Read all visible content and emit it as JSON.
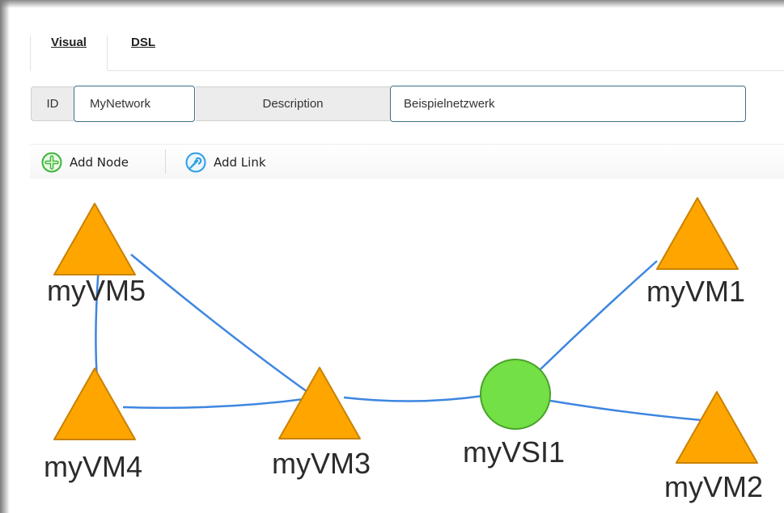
{
  "tabs": [
    {
      "label": "Visual",
      "active": true
    },
    {
      "label": "DSL",
      "active": false
    }
  ],
  "form": {
    "id_label": "ID",
    "id_value": "MyNetwork",
    "description_label": "Description",
    "description_value": "Beispielnetzwerk"
  },
  "toolbar": {
    "add_node_label": "Add Node",
    "add_node_icon": "plus-circle-icon",
    "add_link_label": "Add Link",
    "add_link_icon": "link-icon"
  },
  "graph": {
    "colors": {
      "vm": "#ffa500",
      "vm_stroke": "#c98200",
      "vsi": "#73e045",
      "vsi_stroke": "#4aa22a",
      "edge": "#3d86e0"
    },
    "nodes": [
      {
        "id": "myVM5",
        "label": "myVM5",
        "type": "vm"
      },
      {
        "id": "myVM4",
        "label": "myVM4",
        "type": "vm"
      },
      {
        "id": "myVM3",
        "label": "myVM3",
        "type": "vm"
      },
      {
        "id": "myVSI1",
        "label": "myVSI1",
        "type": "vsi"
      },
      {
        "id": "myVM1",
        "label": "myVM1",
        "type": "vm"
      },
      {
        "id": "myVM2",
        "label": "myVM2",
        "type": "vm"
      }
    ],
    "edges": [
      {
        "from": "myVM5",
        "to": "myVM4"
      },
      {
        "from": "myVM5",
        "to": "myVM3"
      },
      {
        "from": "myVM4",
        "to": "myVM3"
      },
      {
        "from": "myVM3",
        "to": "myVSI1"
      },
      {
        "from": "myVSI1",
        "to": "myVM1"
      },
      {
        "from": "myVSI1",
        "to": "myVM2"
      }
    ]
  }
}
